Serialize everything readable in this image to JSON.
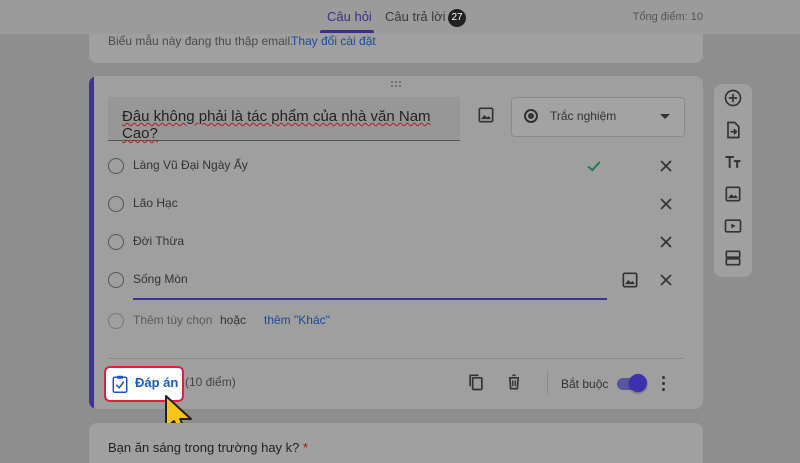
{
  "tabs": [
    {
      "label": "Câu hỏi"
    },
    {
      "label": "Câu trả lời",
      "badge": "27"
    }
  ],
  "total_points": "Tổng điểm: 10",
  "email_notice": {
    "text": "Biểu mẫu này đang thu thập email.",
    "link": "Thay đổi cài đặt"
  },
  "question": {
    "title": "Đâu không phải là tác phẩm của nhà văn Nam Cao?",
    "type": "Trắc nghiệm",
    "options": [
      {
        "label": "Làng Vũ Đại Ngày Ấy",
        "correct": true
      },
      {
        "label": "Lão Hạc",
        "correct": false
      },
      {
        "label": "Đời Thừa",
        "correct": false
      },
      {
        "label": "Sống Mòn",
        "correct": false
      }
    ],
    "add_option": "Thêm tùy chọn",
    "or": "hoặc",
    "add_other": "thêm \"Khác\"",
    "points": "(10 điểm)",
    "answer_key": "Đáp án",
    "required": "Bắt buộc",
    "required_on": true
  },
  "next_question": {
    "title": "Bạn ăn sáng trong trường hay k?",
    "required_mark": "*"
  },
  "icons": {
    "toolbar": [
      "add-question-icon",
      "import-questions-icon",
      "add-title-icon",
      "add-image-icon",
      "add-video-icon",
      "add-section-icon"
    ]
  },
  "colors": {
    "accent": "#3c3399",
    "answer_border": "#e0203a",
    "answer_text": "#1a56c8",
    "check": "#1e7b43"
  }
}
